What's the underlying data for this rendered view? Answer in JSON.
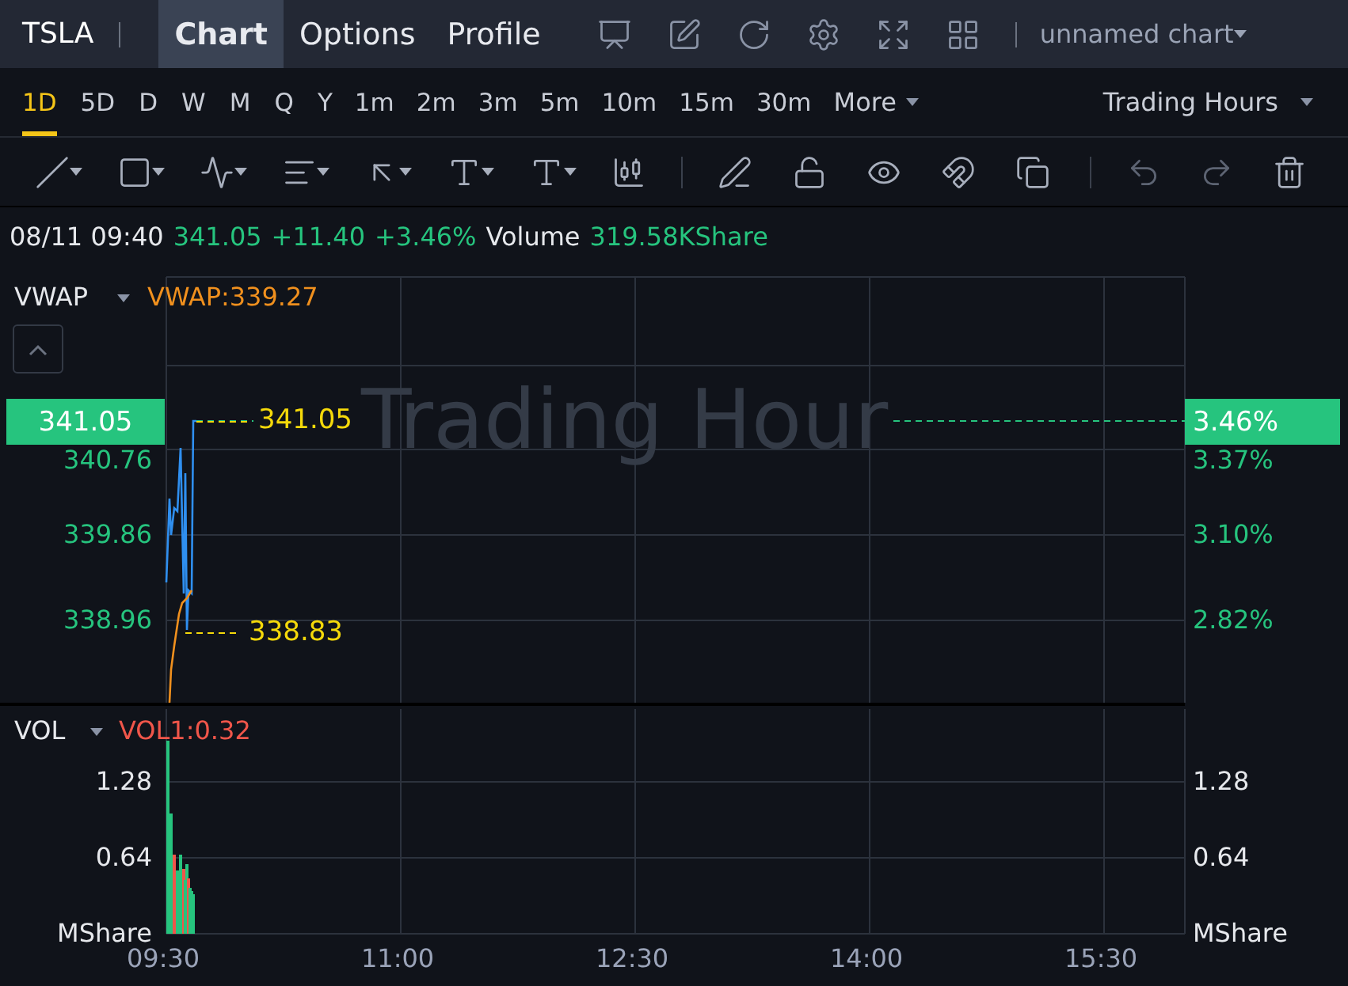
{
  "top_bar": {
    "symbol": "TSLA",
    "tabs": [
      {
        "label": "Chart",
        "selected": true
      },
      {
        "label": "Options",
        "selected": false
      },
      {
        "label": "Profile",
        "selected": false
      }
    ],
    "chart_name": "unnamed chart"
  },
  "periods": [
    {
      "label": "1D",
      "selected": true
    },
    {
      "label": "5D",
      "selected": false
    },
    {
      "label": "D",
      "selected": false
    },
    {
      "label": "W",
      "selected": false
    },
    {
      "label": "M",
      "selected": false
    },
    {
      "label": "Q",
      "selected": false
    },
    {
      "label": "Y",
      "selected": false
    },
    {
      "label": "1m",
      "selected": false
    },
    {
      "label": "2m",
      "selected": false
    },
    {
      "label": "3m",
      "selected": false
    },
    {
      "label": "5m",
      "selected": false
    },
    {
      "label": "10m",
      "selected": false
    },
    {
      "label": "15m",
      "selected": false
    },
    {
      "label": "30m",
      "selected": false
    }
  ],
  "more": "More",
  "session": "Trading Hours",
  "info": {
    "datetime": "08/11 09:40",
    "price": "341.05",
    "change": "+11.40",
    "change_pct": "+3.46%",
    "volume_label": "Volume",
    "volume_value": "319.58KShare"
  },
  "main_pane": {
    "indicator": "VWAP",
    "indicator_value": "VWAP:339.27",
    "watermark": "Trading Hour",
    "price_tag": "341.05",
    "price_label": "341.05",
    "low_label": "338.83",
    "left_ticks": [
      "340.76",
      "339.86",
      "338.96"
    ],
    "right_ticks": [
      "3.37%",
      "3.10%",
      "2.82%"
    ],
    "pct_tag": "3.46%"
  },
  "vol_pane": {
    "indicator": "VOL",
    "indicator_value": "VOL1:0.32",
    "left_ticks": [
      "1.28",
      "0.64",
      "MShare"
    ],
    "right_ticks": [
      "1.28",
      "0.64",
      "MShare"
    ]
  },
  "x_axis": [
    "09:30",
    "11:00",
    "12:30",
    "14:00",
    "15:30"
  ]
}
